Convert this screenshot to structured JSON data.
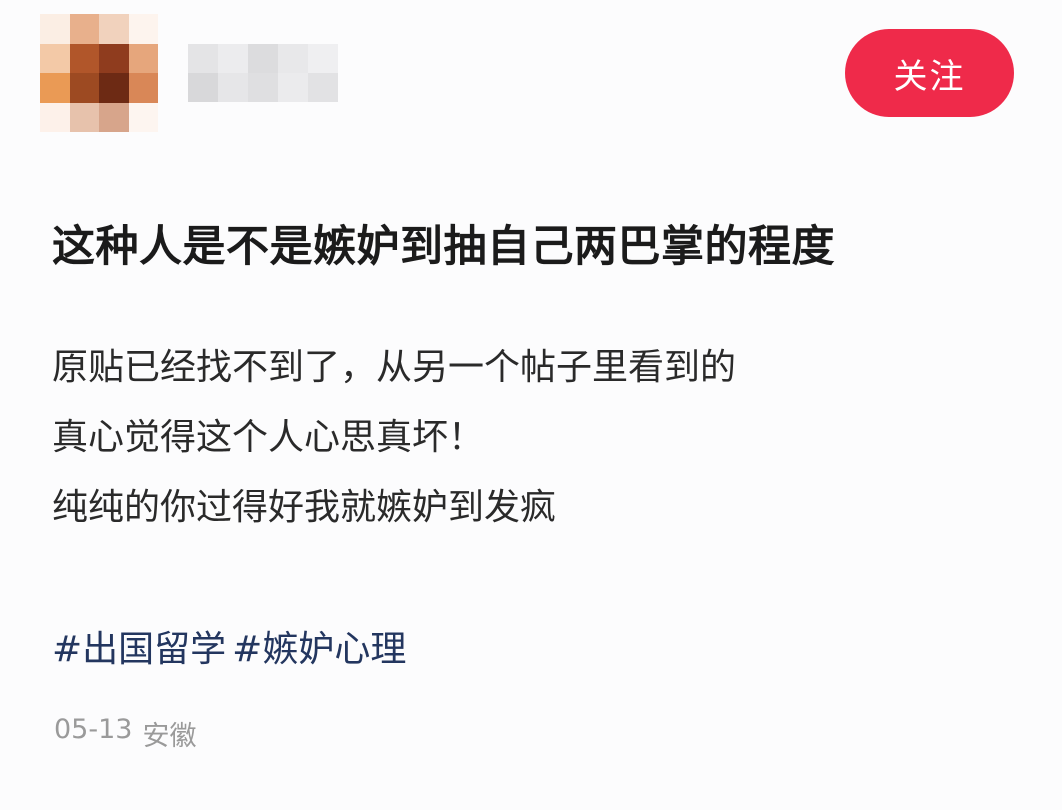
{
  "author": {
    "avatar_colors": [
      "#fbeee4",
      "#e8b08c",
      "#f1d2bd",
      "#fdf4ee",
      "#f3c9a7",
      "#b1562a",
      "#8f3c1e",
      "#e6a67c",
      "#ea9a55",
      "#9d4a22",
      "#6d2a14",
      "#d98757",
      "#fdf1ea",
      "#e7c2ac",
      "#d7a58b",
      "#fdf5f0"
    ],
    "username_colors": [
      "#e4e4e6",
      "#ececee",
      "#dcdcde",
      "#e8e8ea",
      "#efeff1",
      "#d8d8da",
      "#e6e6e8",
      "#dfdfe1",
      "#ebebed",
      "#e2e2e4"
    ]
  },
  "follow_button": {
    "label": "关注",
    "color": "#ef2a4a"
  },
  "post": {
    "title": "这种人是不是嫉妒到抽自己两巴掌的程度",
    "lines": [
      "原贴已经找不到了，从另一个帖子里看到的",
      "真心觉得这个人心思真坏！",
      "纯纯的你过得好我就嫉妒到发疯"
    ],
    "tags": [
      "#出国留学",
      "#嫉妒心理"
    ],
    "date": "05-13",
    "location": "安徽"
  }
}
